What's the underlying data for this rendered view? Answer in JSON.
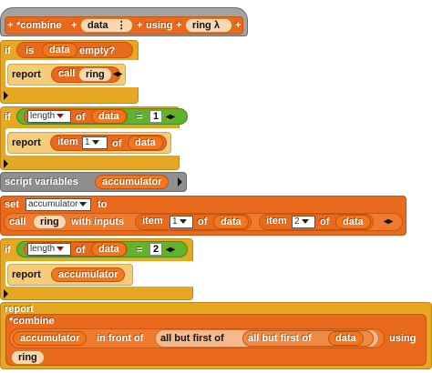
{
  "hat": {
    "plus": "+",
    "name": "*combine",
    "param_data": "data",
    "param_marker": "⋮",
    "using": "using",
    "param_ring": "ring λ"
  },
  "if1": {
    "label": "if",
    "is": "is",
    "var": "data",
    "empty": "empty?",
    "report": "report",
    "call": "call",
    "ring": "ring",
    "arrows": "◂▸"
  },
  "if2": {
    "label": "if",
    "length": "length",
    "of": "of",
    "var": "data",
    "eq": "=",
    "value": "1",
    "report": "report",
    "item": "item",
    "index": "1",
    "of2": "of",
    "var2": "data",
    "arrows": "◂▸"
  },
  "script_vars": {
    "label": "script variables",
    "var": "accumulator"
  },
  "set": {
    "label": "set",
    "var": "accumulator",
    "to": "to",
    "call": "call",
    "ring": "ring",
    "with_inputs": "with inputs",
    "item1": "item",
    "idx1": "1",
    "of1": "of",
    "data1": "data",
    "item2": "item",
    "idx2": "2",
    "of2": "of",
    "data2": "data",
    "arrows": "◂▸"
  },
  "if3": {
    "label": "if",
    "length": "length",
    "of": "of",
    "var": "data",
    "eq": "=",
    "value": "2",
    "report": "report",
    "acc": "accumulator",
    "arrows": "◂▸"
  },
  "final_report": {
    "report": "report",
    "combine": "*combine",
    "acc": "accumulator",
    "in_front_of": "in front of",
    "all_but_first_outer": "all but first of",
    "all_but_first_inner": "all but first of",
    "data": "data",
    "using": "using",
    "ring": "ring"
  },
  "colors": {
    "control": "#e6a822",
    "variables": "#e9691d",
    "operators": "#62b12f",
    "other": "#8f8f8f"
  }
}
